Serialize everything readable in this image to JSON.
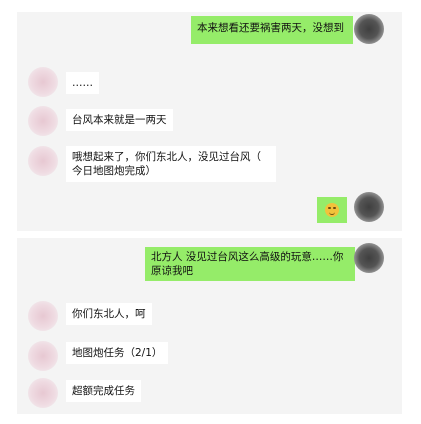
{
  "panel1": {
    "messages": [
      {
        "side": "right",
        "text": "本来想看还要祸害两天，没想到"
      },
      {
        "side": "left",
        "text": "……"
      },
      {
        "side": "left",
        "text": "台风本来就是一两天"
      },
      {
        "side": "left",
        "lines": [
          "哦想起来了，你们东北人，没见过台风（",
          "今日地图炮完成）"
        ]
      },
      {
        "side": "right",
        "emoji": "smiling-face-emoji"
      }
    ]
  },
  "panel2": {
    "messages": [
      {
        "side": "right",
        "lines": [
          "北方人 没见过台风这么高级的玩意……你",
          "原谅我吧"
        ]
      },
      {
        "side": "left",
        "text": "你们东北人，呵"
      },
      {
        "side": "left",
        "text": "地图炮任务（2/1）"
      },
      {
        "side": "left",
        "text": "超额完成任务"
      }
    ]
  }
}
